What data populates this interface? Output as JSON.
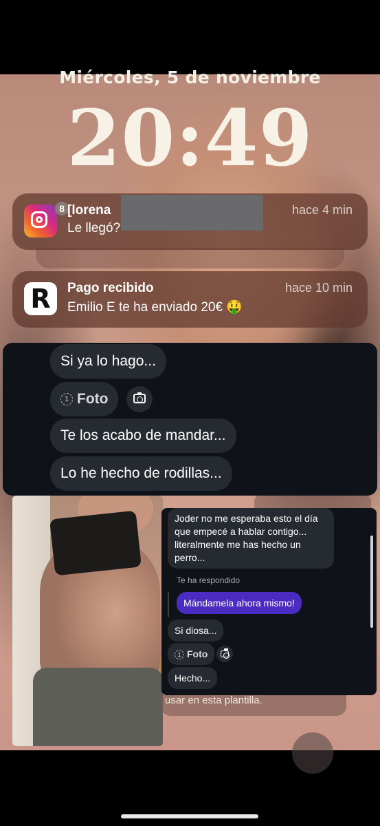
{
  "lockscreen": {
    "date": "Miércoles, 5 de noviembre",
    "time": "20:49"
  },
  "notifications": [
    {
      "app": "instagram",
      "icon": "instagram-icon",
      "badge": "8",
      "title": "[lorena",
      "body": "Le llegó?",
      "time": "hace 4 min"
    },
    {
      "app": "revolut",
      "icon": "revolut-icon",
      "title": "Pago recibido",
      "body": "Emilio E te ha enviado 20€ 🤑",
      "time": "hace 10 min"
    }
  ],
  "chat_top": {
    "messages": [
      {
        "text": "Si ya lo hago..."
      },
      {
        "text": "Foto",
        "type": "view-once-photo",
        "counter": "1"
      },
      {
        "text": "Te los acabo de mandar..."
      },
      {
        "text": "Lo he hecho de rodillas..."
      }
    ]
  },
  "chat_bottom": {
    "messages": [
      {
        "text": "Joder no me esperaba esto el día que empecé a hablar contigo... literalmente me has hecho un perro..."
      },
      {
        "reply_header": "Te ha respondido"
      },
      {
        "text": "Mándamela ahora mismo!",
        "style": "purple"
      },
      {
        "text": "Si diosa..."
      },
      {
        "text": "Foto",
        "type": "view-once-photo",
        "counter": "1"
      },
      {
        "text": "Hecho..."
      }
    ]
  },
  "behind_text": "usar en esta plantilla.",
  "colors": {
    "chat_bg": "#0f1218",
    "bubble": "#262a31",
    "accent_purple": "#4b2cc2"
  }
}
